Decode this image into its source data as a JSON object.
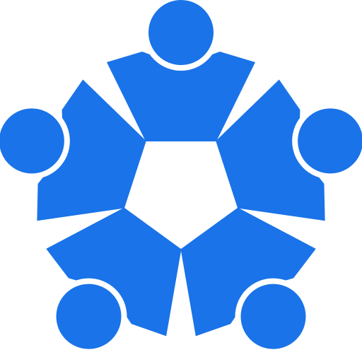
{
  "icon": {
    "name": "community-circle-icon",
    "people_count": 5,
    "color": "#1a73e8",
    "background": "#ffffff"
  }
}
